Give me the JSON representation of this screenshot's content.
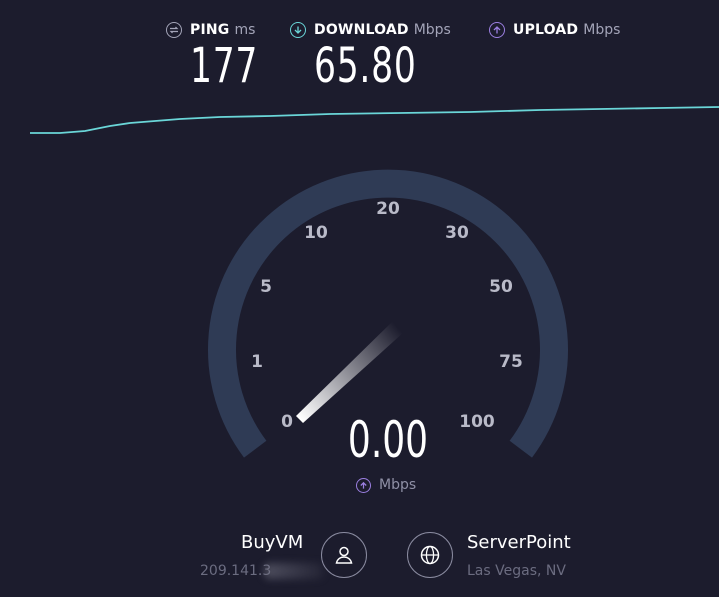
{
  "header": {
    "ping": {
      "label": "PING",
      "unit": "ms",
      "value": "177",
      "icon": "ping-icon"
    },
    "download": {
      "label": "DOWNLOAD",
      "unit": "Mbps",
      "value": "65.80",
      "icon": "download-arrow-icon"
    },
    "upload": {
      "label": "UPLOAD",
      "unit": "Mbps",
      "value": "",
      "icon": "upload-arrow-icon"
    }
  },
  "graph": {
    "color": "#6ad6d8"
  },
  "gauge": {
    "scale_labels": [
      "0",
      "1",
      "5",
      "10",
      "20",
      "30",
      "50",
      "75",
      "100"
    ],
    "current_value": "0.00",
    "unit": "Mbps",
    "track_color": "#2f3b55",
    "accent_upload": "#9b7fe0",
    "accent_download": "#6ad6d8"
  },
  "provider": {
    "name": "BuyVM",
    "ip": "209.141.3",
    "icon": "user-icon"
  },
  "server": {
    "name": "ServerPoint",
    "location": "Las Vegas, NV",
    "icon": "globe-icon"
  }
}
